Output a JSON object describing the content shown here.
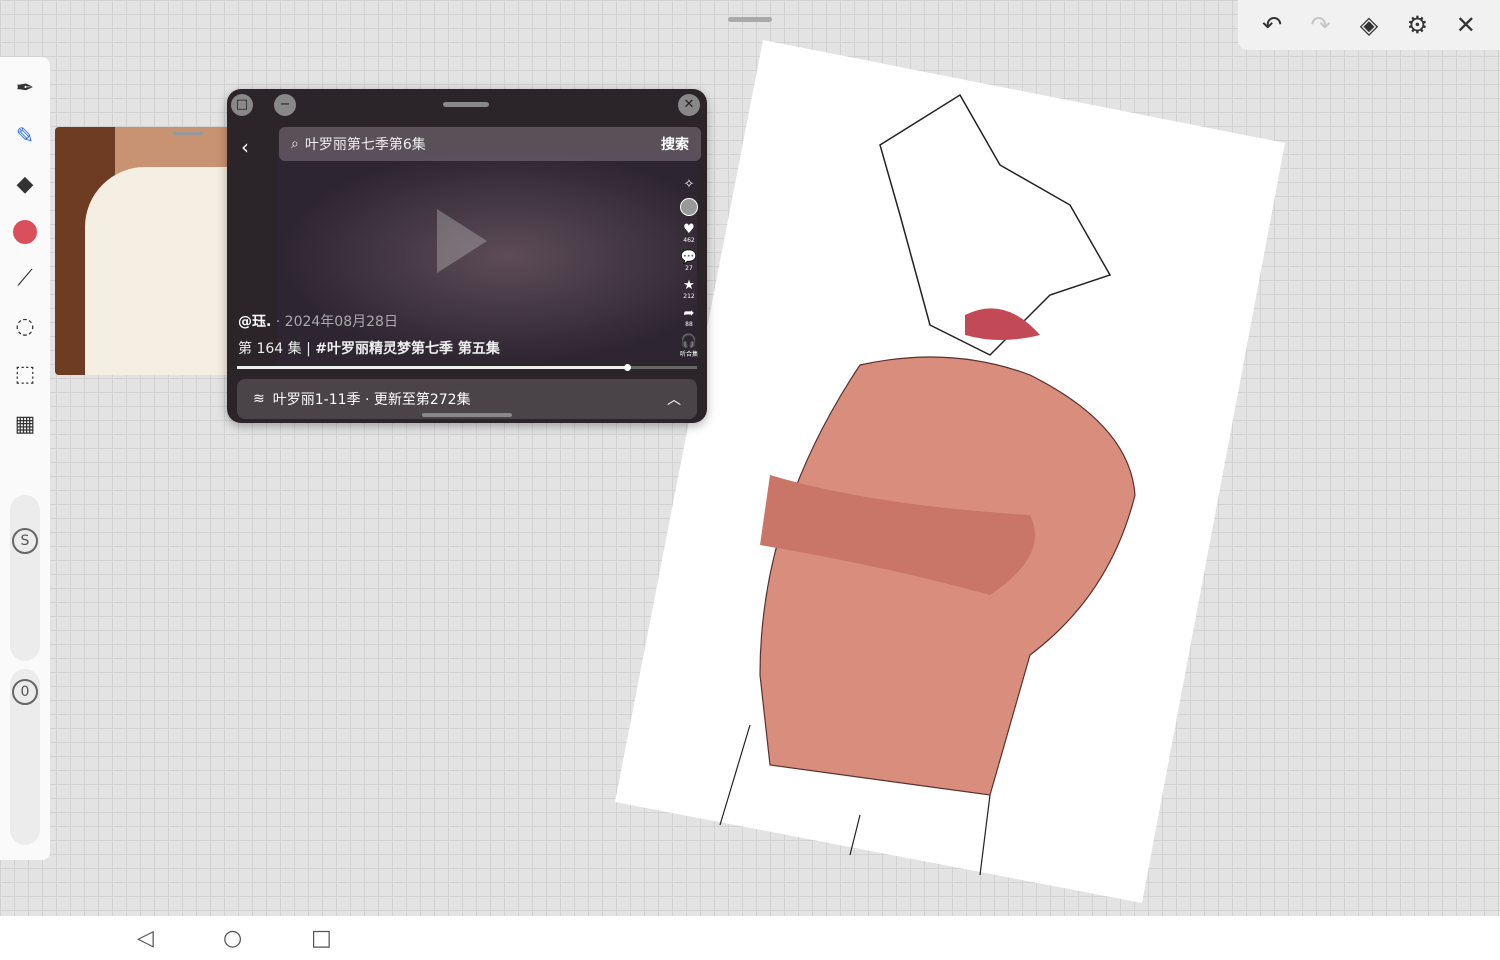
{
  "toolbar": {
    "undo": "undo-icon",
    "redo": "redo-icon",
    "layers": "layers-icon",
    "settings": "gear-icon",
    "close": "close-icon"
  },
  "tools": [
    "pen",
    "brush",
    "eraser",
    "color",
    "smudge",
    "lasso",
    "selection",
    "gallery"
  ],
  "brush_color": "#d9505a",
  "size_label": "S",
  "opacity_label": "0",
  "popup": {
    "search_value": "叶罗丽第七季第6集",
    "search_button": "搜索",
    "author": "@珏.",
    "date": "· 2024年08月28日",
    "episode": "第 164 集",
    "title": "#叶罗丽精灵梦第七季 第五集",
    "counts": {
      "like": "462",
      "comment": "27",
      "favorite": "212",
      "share": "88",
      "listen": "听合集"
    },
    "progress": 0.85,
    "collection": "叶罗丽1-11季 · 更新至第272集"
  }
}
